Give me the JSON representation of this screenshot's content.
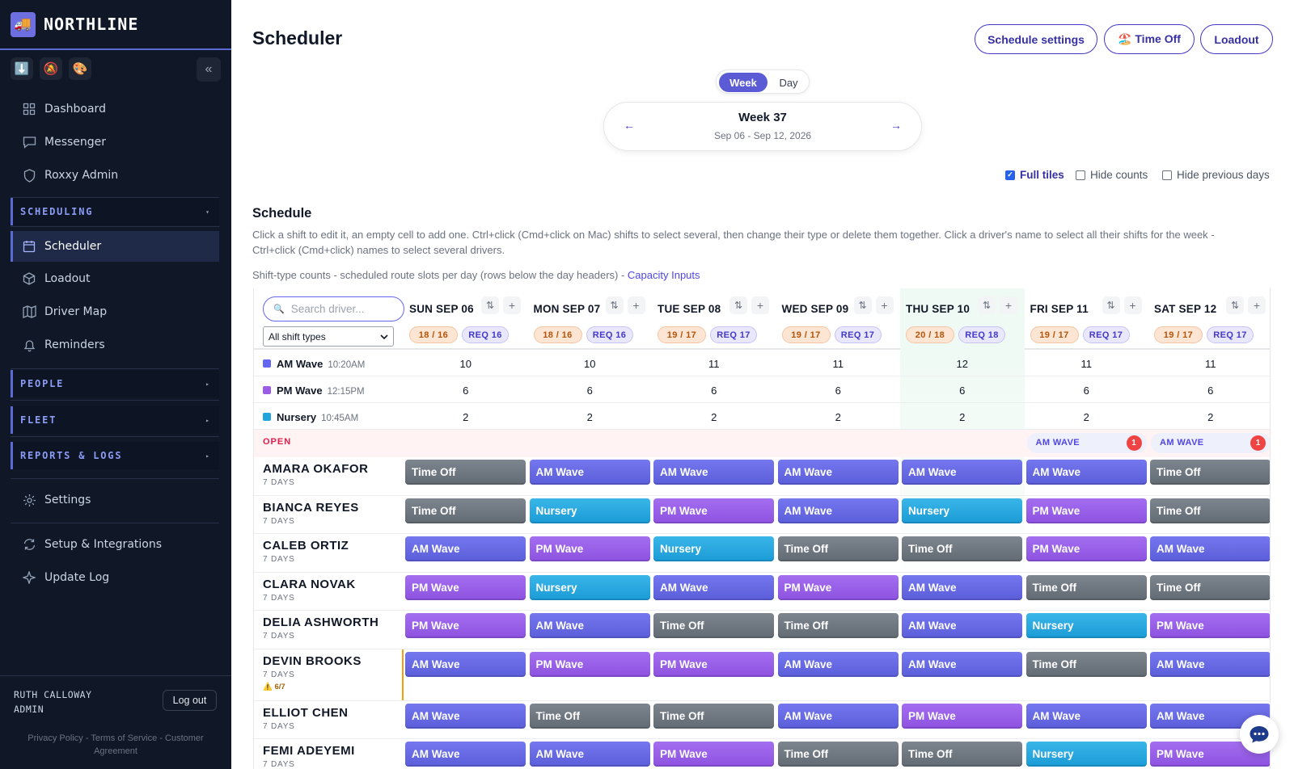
{
  "app": {
    "brand": "NORTHLINE",
    "logo_icon": "🚚"
  },
  "sidebar": {
    "quick_icons": [
      "⬇️",
      "🔕",
      "🎨"
    ],
    "collapse": "«",
    "nav_top": [
      {
        "label": "Dashboard",
        "icon": "dashboard-icon"
      },
      {
        "label": "Messenger",
        "icon": "chat-icon"
      },
      {
        "label": "Roxxy Admin",
        "icon": "shield-icon"
      }
    ],
    "scheduling": {
      "label": "SCHEDULING",
      "arrow": "▾"
    },
    "nav_sched": [
      {
        "label": "Scheduler",
        "icon": "calendar-icon",
        "active": true
      },
      {
        "label": "Loadout",
        "icon": "box-icon"
      },
      {
        "label": "Driver Map",
        "icon": "map-icon"
      },
      {
        "label": "Reminders",
        "icon": "bell-icon"
      }
    ],
    "sections": [
      {
        "label": "PEOPLE",
        "arrow": "▸"
      },
      {
        "label": "FLEET",
        "arrow": "▸"
      },
      {
        "label": "REPORTS & LOGS",
        "arrow": "▸"
      }
    ],
    "nav_bottom": [
      {
        "label": "Settings",
        "icon": "gear-icon"
      },
      {
        "label": "Setup & Integrations",
        "icon": "sync-icon"
      },
      {
        "label": "Update Log",
        "icon": "sparkle-icon"
      }
    ],
    "user": {
      "name": "RUTH CALLOWAY",
      "role": "ADMIN",
      "logout": "Log out"
    },
    "footer": "Privacy Policy - Terms of Service - Customer Agreement"
  },
  "header": {
    "title": "Scheduler",
    "buttons": {
      "settings": "Schedule settings",
      "timeoff": "🏖️ Time Off",
      "loadout": "Loadout"
    }
  },
  "view_toggle": {
    "week": "Week",
    "day": "Day",
    "selected": "Week"
  },
  "week": {
    "label": "Week 37",
    "range": "Sep 06 - Sep 12, 2026",
    "prev": "←",
    "next": "→"
  },
  "options": [
    {
      "label": "Full tiles",
      "checked": true
    },
    {
      "label": "Hide counts",
      "checked": false
    },
    {
      "label": "Hide previous days",
      "checked": false
    }
  ],
  "schedule": {
    "heading": "Schedule",
    "description": "Click a shift to edit it, an empty cell to add one. Ctrl+click (Cmd+click on Mac) shifts to select several, then change their type or delete them together. Click a driver's name to select all their shifts for the week - Ctrl+click (Cmd+click) names to select several drivers.",
    "counts_note": "Shift-type counts - scheduled route slots per day (rows below the day headers) -",
    "counts_link": "Capacity Inputs"
  },
  "grid": {
    "search_placeholder": "Search driver...",
    "filter_value": "All shift types",
    "days": [
      {
        "name": "SUN SEP 06",
        "count": "18 / 16",
        "req": "REQ 16",
        "stripe": "#4b5563"
      },
      {
        "name": "MON SEP 07",
        "count": "18 / 16",
        "req": "REQ 16",
        "stripe": "#4b5563"
      },
      {
        "name": "TUE SEP 08",
        "count": "19 / 17",
        "req": "REQ 17",
        "stripe": "#4b5563"
      },
      {
        "name": "WED SEP 09",
        "count": "19 / 17",
        "req": "REQ 17",
        "stripe": "#4b5563"
      },
      {
        "name": "THU SEP 10",
        "count": "20 / 18",
        "req": "REQ 18",
        "stripe": "#22a36b",
        "today": true
      },
      {
        "name": "FRI SEP 11",
        "count": "19 / 17",
        "req": "REQ 17",
        "stripe": "#ea7b16"
      },
      {
        "name": "SAT SEP 12",
        "count": "19 / 17",
        "req": "REQ 17",
        "stripe": "#ea7b16"
      }
    ],
    "shift_types": [
      {
        "name": "AM Wave",
        "time": "10:20AM",
        "color": "#6366f1",
        "counts": [
          10,
          10,
          11,
          11,
          12,
          11,
          11
        ]
      },
      {
        "name": "PM Wave",
        "time": "12:15PM",
        "color": "#9b5de5",
        "counts": [
          6,
          6,
          6,
          6,
          6,
          6,
          6
        ]
      },
      {
        "name": "Nursery",
        "time": "10:45AM",
        "color": "#1fa4dc",
        "counts": [
          2,
          2,
          2,
          2,
          2,
          2,
          2
        ]
      }
    ],
    "open": {
      "label": "OPEN",
      "chips": [
        {
          "day": 5,
          "label": "AM WAVE",
          "count": "1"
        },
        {
          "day": 6,
          "label": "AM WAVE",
          "count": "1"
        }
      ]
    },
    "drivers": [
      {
        "name": "AMARA OKAFOR",
        "days": "7 DAYS",
        "shifts": [
          "Time Off",
          "AM Wave",
          "AM Wave",
          "AM Wave",
          "AM Wave",
          "AM Wave",
          "Time Off"
        ]
      },
      {
        "name": "BIANCA REYES",
        "days": "7 DAYS",
        "shifts": [
          "Time Off",
          "Nursery",
          "PM Wave",
          "AM Wave",
          "Nursery",
          "PM Wave",
          "Time Off"
        ]
      },
      {
        "name": "CALEB ORTIZ",
        "days": "7 DAYS",
        "shifts": [
          "AM Wave",
          "PM Wave",
          "Nursery",
          "Time Off",
          "Time Off",
          "PM Wave",
          "AM Wave"
        ]
      },
      {
        "name": "CLARA NOVAK",
        "days": "7 DAYS",
        "shifts": [
          "PM Wave",
          "Nursery",
          "AM Wave",
          "PM Wave",
          "AM Wave",
          "Time Off",
          "Time Off"
        ]
      },
      {
        "name": "DELIA ASHWORTH",
        "days": "7 DAYS",
        "shifts": [
          "PM Wave",
          "AM Wave",
          "Time Off",
          "Time Off",
          "AM Wave",
          "Nursery",
          "PM Wave"
        ]
      },
      {
        "name": "DEVIN BROOKS",
        "days": "7 DAYS",
        "warning": "⚠️ 6/7",
        "shifts": [
          "AM Wave",
          "PM Wave",
          "PM Wave",
          "AM Wave",
          "AM Wave",
          "Time Off",
          "AM Wave"
        ]
      },
      {
        "name": "ELLIOT CHEN",
        "days": "7 DAYS",
        "shifts": [
          "AM Wave",
          "Time Off",
          "Time Off",
          "AM Wave",
          "PM Wave",
          "AM Wave",
          "AM Wave"
        ]
      },
      {
        "name": "FEMI ADEYEMI",
        "days": "7 DAYS",
        "shifts": [
          "AM Wave",
          "AM Wave",
          "PM Wave",
          "Time Off",
          "Time Off",
          "Nursery",
          "PM Wave"
        ]
      }
    ]
  },
  "chat": {
    "icon": "chat-bubble-icon"
  }
}
